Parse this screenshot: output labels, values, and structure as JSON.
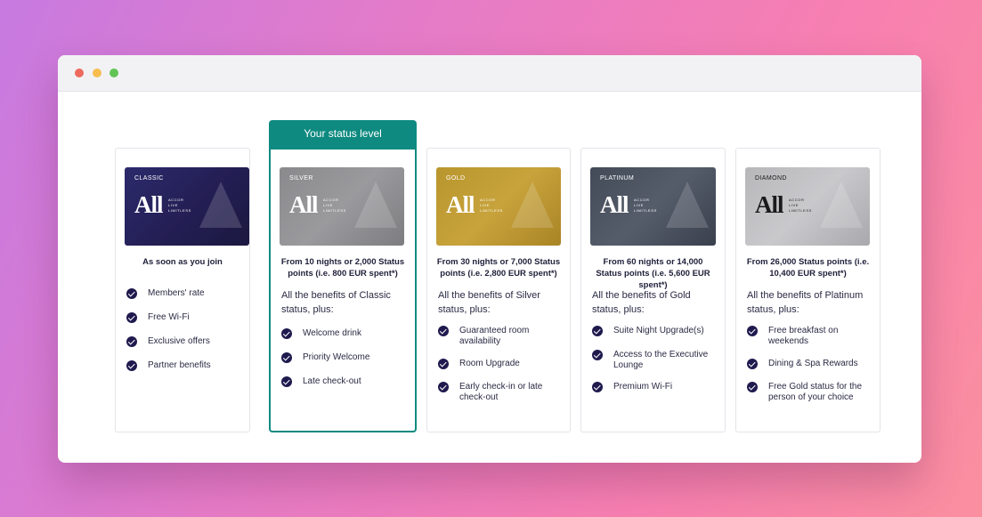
{
  "status_banner": "Your status level",
  "tiers": [
    {
      "card_name": "CLASSIC",
      "card_logo": "All",
      "card_logo_sub": [
        "ACCOR",
        "LIVE",
        "LIMITLESS"
      ],
      "requirement": "As soon as you join",
      "intro": "",
      "benefits": [
        "Members' rate",
        "Free Wi-Fi",
        "Exclusive offers",
        "Partner benefits"
      ],
      "card_color": "#241f55"
    },
    {
      "card_name": "SILVER",
      "card_logo": "All",
      "card_logo_sub": [
        "ACCOR",
        "LIVE",
        "LIMITLESS"
      ],
      "requirement": "From 10 nights or 2,000 Status points (i.e. 800 EUR spent*)",
      "intro": "All the benefits of Classic status, plus:",
      "benefits": [
        "Welcome drink",
        "Priority Welcome",
        "Late check-out"
      ],
      "card_color": "#9a9a9d",
      "current": true
    },
    {
      "card_name": "GOLD",
      "card_logo": "All",
      "card_logo_sub": [
        "ACCOR",
        "LIVE",
        "LIMITLESS"
      ],
      "requirement": "From 30 nights or 7,000 Status points (i.e. 2,800 EUR spent*)",
      "intro": "All the benefits of Silver status, plus:",
      "benefits": [
        "Guaranteed room availability",
        "Room Upgrade",
        "Early check-in or late check-out"
      ],
      "card_color": "#c8a33c"
    },
    {
      "card_name": "PLATINUM",
      "card_logo": "All",
      "card_logo_sub": [
        "ACCOR",
        "LIVE",
        "LIMITLESS"
      ],
      "requirement": "From 60 nights or 14,000 Status points (i.e. 5,600 EUR spent*)",
      "intro": "All the benefits of Gold status, plus:",
      "benefits": [
        "Suite Night Upgrade(s)",
        "Access to the Executive Lounge",
        "Premium Wi-Fi"
      ],
      "card_color": "#555d6b"
    },
    {
      "card_name": "DIAMOND",
      "card_logo": "All",
      "card_logo_sub": [
        "ACCOR",
        "LIVE",
        "LIMITLESS"
      ],
      "requirement": "From 26,000 Status points (i.e. 10,400 EUR spent*)",
      "intro": "All the benefits of Platinum status, plus:",
      "benefits": [
        "Free breakfast on weekends",
        "Dining & Spa Rewards",
        "Free Gold status for the person of your choice"
      ],
      "card_color": "#c9c9cc"
    }
  ],
  "colors": {
    "accent_teal": "#0e8a80",
    "check_navy": "#1f1a4e"
  },
  "icons": {
    "benefit": "check-circle-icon"
  }
}
